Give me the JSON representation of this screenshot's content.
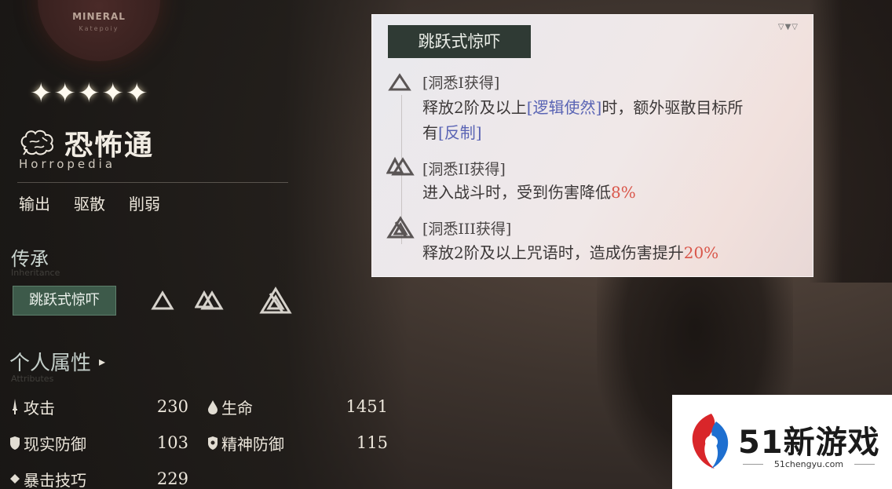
{
  "emblem": {
    "title": "MINERAL",
    "subtitle": "Katepoiy"
  },
  "character": {
    "stars": [
      "✦",
      "✦",
      "✦",
      "✦",
      "✦"
    ],
    "name": "恐怖通",
    "name_en": "Horropedia",
    "roles": [
      "输出",
      "驱散",
      "削弱"
    ]
  },
  "inheritance": {
    "title": "传承",
    "subtitle": "Inheritance",
    "button_label": "跳跃式惊吓",
    "icons": [
      "triangle-level-1-icon",
      "triangle-level-2-icon",
      "triangle-level-3-icon"
    ]
  },
  "attributes": {
    "title": "个人属性",
    "subtitle": "Attributes",
    "arrow": "▸",
    "items": [
      {
        "label": "攻击",
        "value": "230",
        "icon": "sword-icon"
      },
      {
        "label": "生命",
        "value": "1451",
        "icon": "drop-icon"
      },
      {
        "label": "现实防御",
        "value": "103",
        "icon": "shield-icon"
      },
      {
        "label": "精神防御",
        "value": "115",
        "icon": "mind-shield-icon"
      },
      {
        "label": "暴击技巧",
        "value": "229",
        "icon": "crit-icon"
      }
    ]
  },
  "tooltip": {
    "title": "跳跃式惊吓",
    "corner": "▽▼▽",
    "entries": [
      {
        "heading": "[洞悉I获得]",
        "line1_a": "释放2阶及以上",
        "line1_kw": "[逻辑使然]",
        "line1_b": "时，额外驱散目标所",
        "line2_a": "有",
        "line2_kw": "[反制]"
      },
      {
        "heading": "[洞悉II获得]",
        "text_a": "进入战斗时，受到伤害降低",
        "text_num": "8%"
      },
      {
        "heading": "[洞悉III获得]",
        "text_a": "释放2阶及以上咒语时，造成伤害提升",
        "text_num": "20%"
      }
    ]
  },
  "watermark": {
    "brand": "51新游戏",
    "url": "51chengyu.com"
  },
  "colors": {
    "accent_green": "#3d5a4a",
    "keyword": "#5a64b4",
    "number": "#d9564a"
  }
}
